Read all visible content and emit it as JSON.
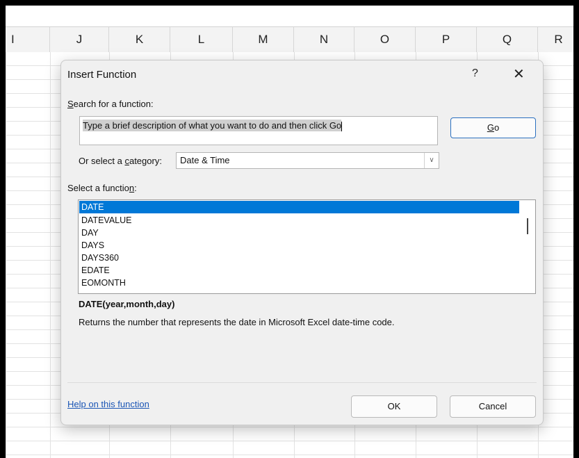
{
  "spreadsheet": {
    "columns": [
      "I",
      "J",
      "K",
      "L",
      "M",
      "N",
      "O",
      "P",
      "Q",
      "R"
    ]
  },
  "dialog": {
    "title": "Insert Function",
    "help_glyph": "?",
    "close_glyph": "✕",
    "search_label_key": "S",
    "search_label_rest": "earch for a function:",
    "search_value": "Type a brief description of what you want to do and then click Go",
    "go_key": "G",
    "go_rest": "o",
    "category_label_pre": "Or select a ",
    "category_label_key": "c",
    "category_label_post": "ategory:",
    "category_value": "Date & Time",
    "function_label_pre": "Select a functio",
    "function_label_key": "n",
    "function_label_post": ":",
    "functions": [
      "DATE",
      "DATEVALUE",
      "DAY",
      "DAYS",
      "DAYS360",
      "EDATE",
      "EOMONTH"
    ],
    "selected_function": "DATE",
    "signature": "DATE(year,month,day)",
    "description": "Returns the number that represents the date in Microsoft Excel date-time code.",
    "help_link": "Help on this function",
    "ok_label": "OK",
    "cancel_label": "Cancel"
  },
  "colors": {
    "selection": "#0078d7",
    "link": "#1a55b5",
    "dialog_bg": "#f0f0f0"
  }
}
